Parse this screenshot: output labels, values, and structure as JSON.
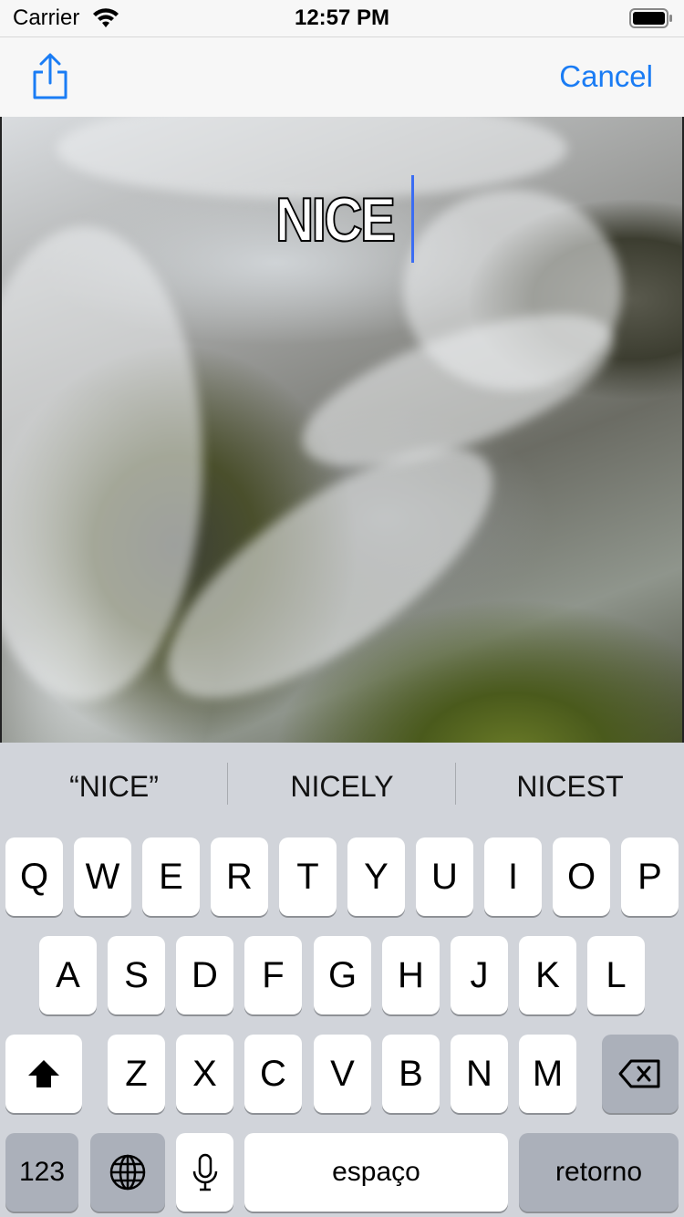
{
  "status_bar": {
    "carrier": "Carrier",
    "time": "12:57 PM",
    "icons": [
      "wifi-icon",
      "battery-icon"
    ]
  },
  "nav_bar": {
    "share_icon": "share-icon",
    "cancel_label": "Cancel",
    "accent_color": "#1a7cf4"
  },
  "editor": {
    "meme_text": "NICE",
    "caret_color": "#3b6df3"
  },
  "keyboard": {
    "suggestions": [
      "“NICE”",
      "NICELY",
      "NICEST"
    ],
    "row1": [
      "Q",
      "W",
      "E",
      "R",
      "T",
      "Y",
      "U",
      "I",
      "O",
      "P"
    ],
    "row2": [
      "A",
      "S",
      "D",
      "F",
      "G",
      "H",
      "J",
      "K",
      "L"
    ],
    "row3": [
      "Z",
      "X",
      "C",
      "V",
      "B",
      "N",
      "M"
    ],
    "numbers_label": "123",
    "space_label": "espaço",
    "return_label": "retorno",
    "special_icons": [
      "shift-icon",
      "delete-icon",
      "globe-icon",
      "microphone-icon"
    ]
  }
}
